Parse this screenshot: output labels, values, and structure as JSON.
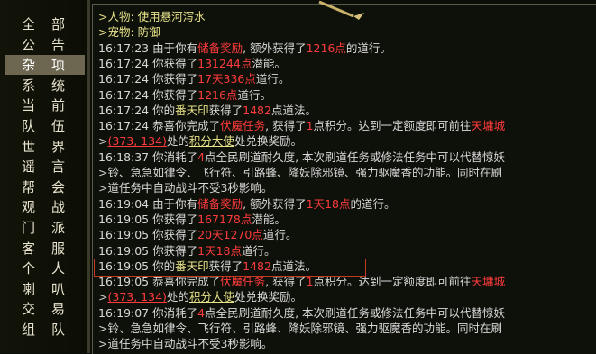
{
  "sidebar": {
    "items": [
      {
        "label": "全部"
      },
      {
        "label": "公告"
      },
      {
        "label": "杂项"
      },
      {
        "label": "系统"
      },
      {
        "label": "当前"
      },
      {
        "label": "队伍"
      },
      {
        "label": "世界"
      },
      {
        "label": "谣言"
      },
      {
        "label": "帮会"
      },
      {
        "label": "观战"
      },
      {
        "label": "门派"
      },
      {
        "label": "客服"
      },
      {
        "label": "个人"
      },
      {
        "label": "喇叭"
      },
      {
        "label": "交易"
      },
      {
        "label": "组队"
      }
    ],
    "active_index": 2
  },
  "chat": {
    "lines": [
      [
        {
          "t": ">人物: 使用悬河泻水",
          "c": "y"
        }
      ],
      [
        {
          "t": ">宠物: 防御",
          "c": "y"
        }
      ],
      [
        {
          "t": "16:17:23  由于你有"
        },
        {
          "t": "储备奖励",
          "c": "r"
        },
        {
          "t": ", 额外获得了"
        },
        {
          "t": "1216点",
          "c": "r"
        },
        {
          "t": "的道行。"
        }
      ],
      [
        {
          "t": "16:17:24  你获得了"
        },
        {
          "t": "131244点",
          "c": "r"
        },
        {
          "t": "潜能。"
        }
      ],
      [
        {
          "t": "16:17:24  你获得了"
        },
        {
          "t": "17天336点",
          "c": "r"
        },
        {
          "t": "道行。"
        }
      ],
      [
        {
          "t": "16:17:24  你获得了"
        },
        {
          "t": "1216点",
          "c": "r"
        },
        {
          "t": "道行。"
        }
      ],
      [
        {
          "t": "16:17:24  你的"
        },
        {
          "t": "番天印",
          "c": "y"
        },
        {
          "t": "获得了"
        },
        {
          "t": "1482",
          "c": "r"
        },
        {
          "t": "点道法。"
        }
      ],
      [
        {
          "t": "16:17:24  恭喜你完成了"
        },
        {
          "t": "伏魔任务",
          "c": "r"
        },
        {
          "t": ", 获得了"
        },
        {
          "t": "1",
          "c": "r"
        },
        {
          "t": "点积分。达到一定额度即可前往"
        },
        {
          "t": "天墉城",
          "c": "r"
        }
      ],
      [
        {
          "t": ">"
        },
        {
          "t": "(373, 134)",
          "c": "r",
          "u": true
        },
        {
          "t": "处的"
        },
        {
          "t": "积分大使",
          "c": "y",
          "u": true
        },
        {
          "t": "处兑换奖励。"
        }
      ],
      [
        {
          "t": "16:18:37  你消耗了"
        },
        {
          "t": "4",
          "c": "r"
        },
        {
          "t": "点全民刷道耐久度, 本次刷道任务或修法任务中可以代替惊妖"
        }
      ],
      [
        {
          "t": ">铃、急急如律令、飞行符、引路蜂、降妖除邪镜、强力驱魔香的功能。同时在刷"
        }
      ],
      [
        {
          "t": ">道任务中自动战斗不受3秒影响。"
        }
      ],
      [
        {
          "t": "16:19:04  由于你有"
        },
        {
          "t": "储备奖励",
          "c": "r"
        },
        {
          "t": ", 额外获得了"
        },
        {
          "t": "1天18点",
          "c": "r"
        },
        {
          "t": "的道行。"
        }
      ],
      [
        {
          "t": "16:19:05  你获得了"
        },
        {
          "t": "167178点",
          "c": "r"
        },
        {
          "t": "潜能。"
        }
      ],
      [
        {
          "t": "16:19:05  你获得了"
        },
        {
          "t": "20天1270点",
          "c": "r"
        },
        {
          "t": "道行。"
        }
      ],
      [
        {
          "t": "16:19:05  你获得了"
        },
        {
          "t": "1天18点",
          "c": "r"
        },
        {
          "t": "道行。"
        }
      ],
      [
        {
          "t": "16:19:05  你的"
        },
        {
          "t": "番天印",
          "c": "y"
        },
        {
          "t": "获得了"
        },
        {
          "t": "1482",
          "c": "r"
        },
        {
          "t": "点道法。"
        }
      ],
      [
        {
          "t": "16:19:05  恭喜你完成了"
        },
        {
          "t": "伏魔任务",
          "c": "r"
        },
        {
          "t": ", 获得了"
        },
        {
          "t": "1",
          "c": "r"
        },
        {
          "t": "点积分。达到一定额度即可前往"
        },
        {
          "t": "天墉城",
          "c": "r"
        }
      ],
      [
        {
          "t": ">"
        },
        {
          "t": "(373, 134)",
          "c": "r",
          "u": true
        },
        {
          "t": "处的"
        },
        {
          "t": "积分大使",
          "c": "y",
          "u": true
        },
        {
          "t": "处兑换奖励。"
        }
      ],
      [
        {
          "t": "16:19:07  你消耗了"
        },
        {
          "t": "4",
          "c": "r"
        },
        {
          "t": "点全民刷道耐久度, 本次刷道任务或修法任务中可以代替惊妖"
        }
      ],
      [
        {
          "t": ">铃、急急如律令、飞行符、引路蜂、降妖除邪镜、强力驱魔香的功能。同时在刷"
        }
      ],
      [
        {
          "t": ">道任务中自动战斗不受3秒影响。"
        }
      ]
    ]
  }
}
